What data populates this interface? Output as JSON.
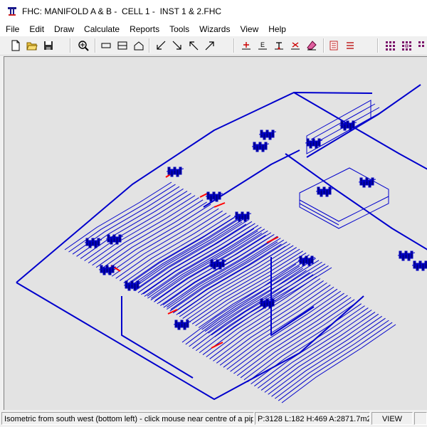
{
  "window": {
    "title": "FHC: MANIFOLD A & B -  CELL 1 -  INST 1 & 2.FHC",
    "icon": "fhc-app-icon"
  },
  "menu": [
    {
      "label": "File"
    },
    {
      "label": "Edit"
    },
    {
      "label": "Draw"
    },
    {
      "label": "Calculate"
    },
    {
      "label": "Reports"
    },
    {
      "label": "Tools"
    },
    {
      "label": "Wizards"
    },
    {
      "label": "View"
    },
    {
      "label": "Help"
    }
  ],
  "toolbar": {
    "buttons": [
      "new-file-icon",
      "open-folder-icon",
      "save-disk-icon",
      "zoom-icon",
      "rectangle-icon",
      "box-icon",
      "house-icon",
      "arrow-down-left-icon",
      "arrow-down-right-icon",
      "arrow-up-left-icon",
      "arrow-up-right-icon",
      "add-node-icon",
      "elevation-icon",
      "sprinkler-icon",
      "delete-pipe-icon",
      "eraser-icon",
      "report-red-icon",
      "list-red-icon",
      "grid-purple-icon",
      "grid-select-icon"
    ]
  },
  "colors": {
    "pipe": "#0000cc",
    "highlight": "#ff0000",
    "canvas": "#e3e3e3"
  },
  "status": {
    "message": "Isometric from south west (bottom left) - click mouse near centre of a pipe t",
    "measure": "P:3128 L:182 H:469 A:2871.7m2",
    "mode": "VIEW"
  }
}
